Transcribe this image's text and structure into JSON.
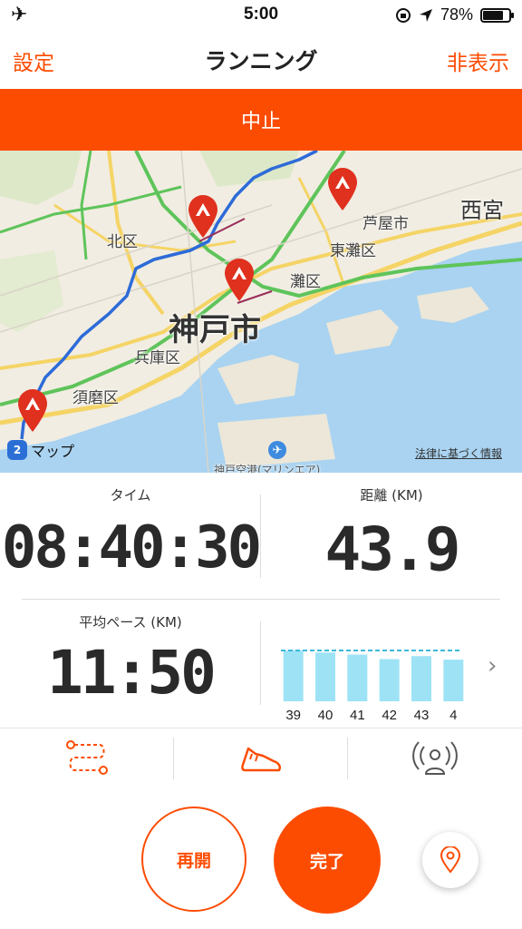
{
  "status_bar": {
    "time": "5:00",
    "battery": "78%",
    "battery_level": 0.78,
    "icons": [
      "airplane-icon",
      "screen-rotation-lock-icon",
      "location-arrow-icon",
      "battery-icon"
    ]
  },
  "nav": {
    "left": "設定",
    "title": "ランニング",
    "right": "非表示"
  },
  "banner": {
    "stop": "中止"
  },
  "map": {
    "labels": {
      "kita": "北区",
      "kobe": "神戸市",
      "hyogo": "兵庫区",
      "suma": "須磨区",
      "nada": "灘区",
      "higashinada": "東灘区",
      "ashiya": "芦屋市",
      "nishinomiya": "西宮",
      "airport": "神戸空港(マリンエア)"
    },
    "maps_logo": "マップ",
    "legal": "法律に基づく情報",
    "route_color": "#2d6bd8",
    "pin_color": "#e0301e"
  },
  "stats": {
    "time_label": "タイム",
    "time_value": "08:40:30",
    "distance_label": "距離 (KM)",
    "distance_value": "43.9",
    "pace_label": "平均ペース (KM)",
    "pace_value": "11:50"
  },
  "chart_data": {
    "type": "bar",
    "categories": [
      "39",
      "40",
      "41",
      "42",
      "43",
      "4"
    ],
    "values": [
      1.0,
      0.96,
      0.92,
      0.83,
      0.89,
      0.82
    ],
    "reference_line": 1.0,
    "color": "#9ee3f5",
    "reference_color": "#3bb8d8"
  },
  "tabs": [
    {
      "name": "route-icon"
    },
    {
      "name": "shoe-icon"
    },
    {
      "name": "beacon-icon"
    }
  ],
  "buttons": {
    "resume": "再開",
    "finish": "完了"
  },
  "accent_color": "#fc4c02"
}
